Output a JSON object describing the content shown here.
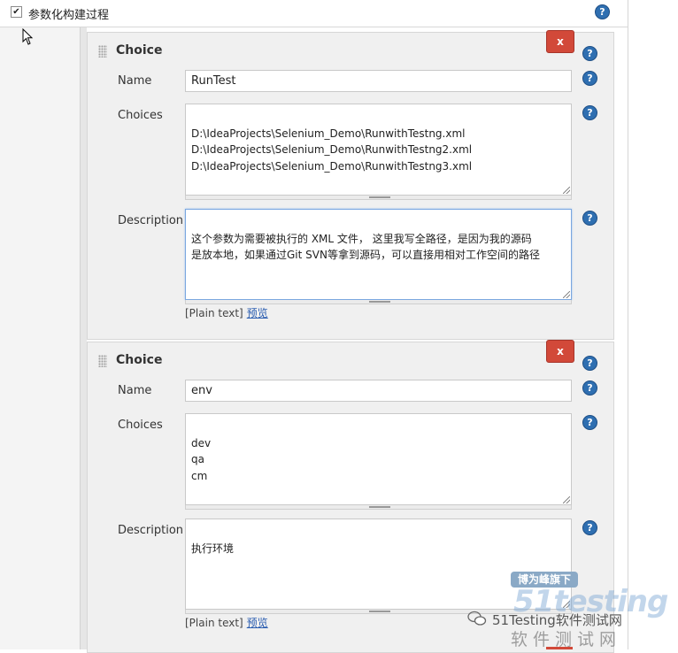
{
  "header": {
    "checkbox_checked": true,
    "checkbox_glyph": "✔",
    "label": "参数化构建过程",
    "help_glyph": "?"
  },
  "parameters": [
    {
      "title": "Choice",
      "remove_label": "x",
      "name_label": "Name",
      "name_value": "RunTest",
      "choices_label": "Choices",
      "choices_value": "D:\\IdeaProjects\\Selenium_Demo\\RunwithTestng.xml\nD:\\IdeaProjects\\Selenium_Demo\\RunwithTestng2.xml\nD:\\IdeaProjects\\Selenium_Demo\\RunwithTestng3.xml",
      "description_label": "Description",
      "description_value": "这个参数为需要被执行的 XML 文件， 这里我写全路径，是因为我的源码\n是放本地，如果通过Git SVN等拿到源码，可以直接用相对工作空间的路径",
      "format_label": "[Plain text]",
      "preview_link": "预览"
    },
    {
      "title": "Choice",
      "remove_label": "x",
      "name_label": "Name",
      "name_value": "env",
      "choices_label": "Choices",
      "choices_value": "dev\nqa\ncm",
      "description_label": "Description",
      "description_value": "执行环境",
      "format_label": "[Plain text]",
      "preview_link": "预览"
    }
  ],
  "watermark": {
    "badge": "博为峰旗下",
    "logo": "51testing",
    "site": "51Testing软件测试网",
    "subtitle": "软件测试网"
  },
  "colors": {
    "accent_help": "#2f6fb1",
    "remove_button": "#d24939",
    "link": "#2a5db0"
  }
}
